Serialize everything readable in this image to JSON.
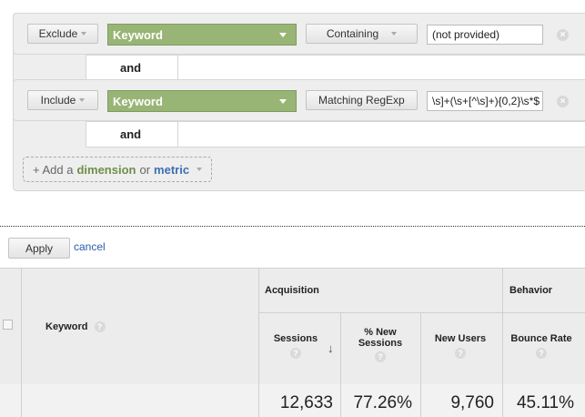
{
  "filters": [
    {
      "mode": "Exclude",
      "dimension": "Keyword",
      "match": "Containing",
      "value": "(not provided)"
    },
    {
      "mode": "Include",
      "dimension": "Keyword",
      "match": "Matching RegExp",
      "value": "\\s]+(\\s+[^\\s]+){0,2}\\s*$"
    }
  ],
  "and_label": "and",
  "add_dimension": {
    "prefix": "+ Add a",
    "dimension": "dimension",
    "or": "or",
    "metric": "metric"
  },
  "actions": {
    "apply": "Apply",
    "cancel": "cancel"
  },
  "table": {
    "keyword_header": "Keyword",
    "groups": [
      "Acquisition",
      "Behavior"
    ],
    "columns": [
      "Sessions",
      "% New Sessions",
      "New Users",
      "Bounce Rate"
    ],
    "totals": [
      "12,633",
      "77.26%",
      "9,760",
      "45.11%"
    ]
  },
  "icons": {
    "help": "?",
    "close": "×",
    "sort": "↓"
  },
  "colors": {
    "dimension_chip": "#98b576",
    "dimension_text": "#6f8f48",
    "metric_text": "#3d6fb5",
    "link": "#2a5db0"
  }
}
